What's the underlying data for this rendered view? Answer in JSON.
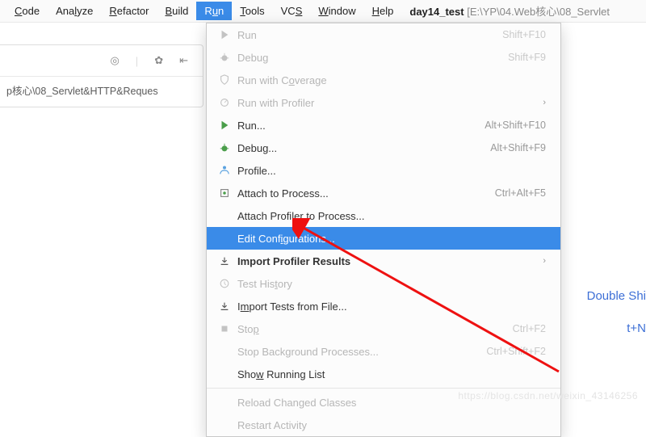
{
  "menubar": {
    "items": [
      {
        "label": "Code",
        "u": 0
      },
      {
        "label": "Analyze",
        "u": 3
      },
      {
        "label": "Refactor",
        "u": 0
      },
      {
        "label": "Build",
        "u": 0
      },
      {
        "label": "Run",
        "u": 1,
        "active": true
      },
      {
        "label": "Tools",
        "u": 0
      },
      {
        "label": "VCS",
        "u": 2
      },
      {
        "label": "Window",
        "u": 0
      },
      {
        "label": "Help",
        "u": 0
      }
    ],
    "project_name": "day14_test",
    "project_path": "[E:\\YP\\04.Web核心\\08_Servlet"
  },
  "breadcrumb": "p核心\\08_Servlet&HTTP&Reques",
  "dropdown": {
    "groups": [
      [
        {
          "icon": "play",
          "label": "Run",
          "shortcut": "Shift+F10",
          "disabled": true,
          "u": -1
        },
        {
          "icon": "bug",
          "label": "Debug",
          "shortcut": "Shift+F9",
          "disabled": true,
          "u": -1
        },
        {
          "icon": "shield",
          "label": "Run with Coverage",
          "disabled": true,
          "u": 10
        },
        {
          "icon": "profiler",
          "label": "Run with Profiler",
          "disabled": true,
          "sub": true
        },
        {
          "icon": "play-green",
          "label": "Run...",
          "shortcut": "Alt+Shift+F10",
          "u": -1
        },
        {
          "icon": "bug-green",
          "label": "Debug...",
          "shortcut": "Alt+Shift+F9",
          "u": -1
        },
        {
          "icon": "profile",
          "label": "Profile...",
          "u": -1
        },
        {
          "icon": "attach",
          "label": "Attach to Process...",
          "shortcut": "Ctrl+Alt+F5",
          "u": -1
        },
        {
          "icon": "",
          "label": "Attach Profiler to Process..."
        },
        {
          "icon": "",
          "label": "Edit Configurations...",
          "highlight": true,
          "u": 9
        },
        {
          "icon": "import",
          "label": "Import Profiler Results",
          "sub": true,
          "bold": true,
          "u": -1
        },
        {
          "icon": "clock",
          "label": "Test History",
          "disabled": true,
          "u": 8
        },
        {
          "icon": "import",
          "label": "Import Tests from File...",
          "u": 1
        },
        {
          "icon": "stop",
          "label": "Stop",
          "shortcut": "Ctrl+F2",
          "disabled": true,
          "u": 3
        },
        {
          "icon": "",
          "label": "Stop Background Processes...",
          "shortcut": "Ctrl+Shift+F2",
          "disabled": true
        },
        {
          "icon": "",
          "label": "Show Running List",
          "u": 3
        }
      ],
      [
        {
          "icon": "",
          "label": "Reload Changed Classes",
          "disabled": true
        },
        {
          "icon": "",
          "label": "Restart Activity",
          "disabled": true
        }
      ]
    ]
  },
  "side": {
    "a": "Double Shi",
    "b": "t+N"
  },
  "watermark": "https://blog.csdn.net/weixin_43146256"
}
